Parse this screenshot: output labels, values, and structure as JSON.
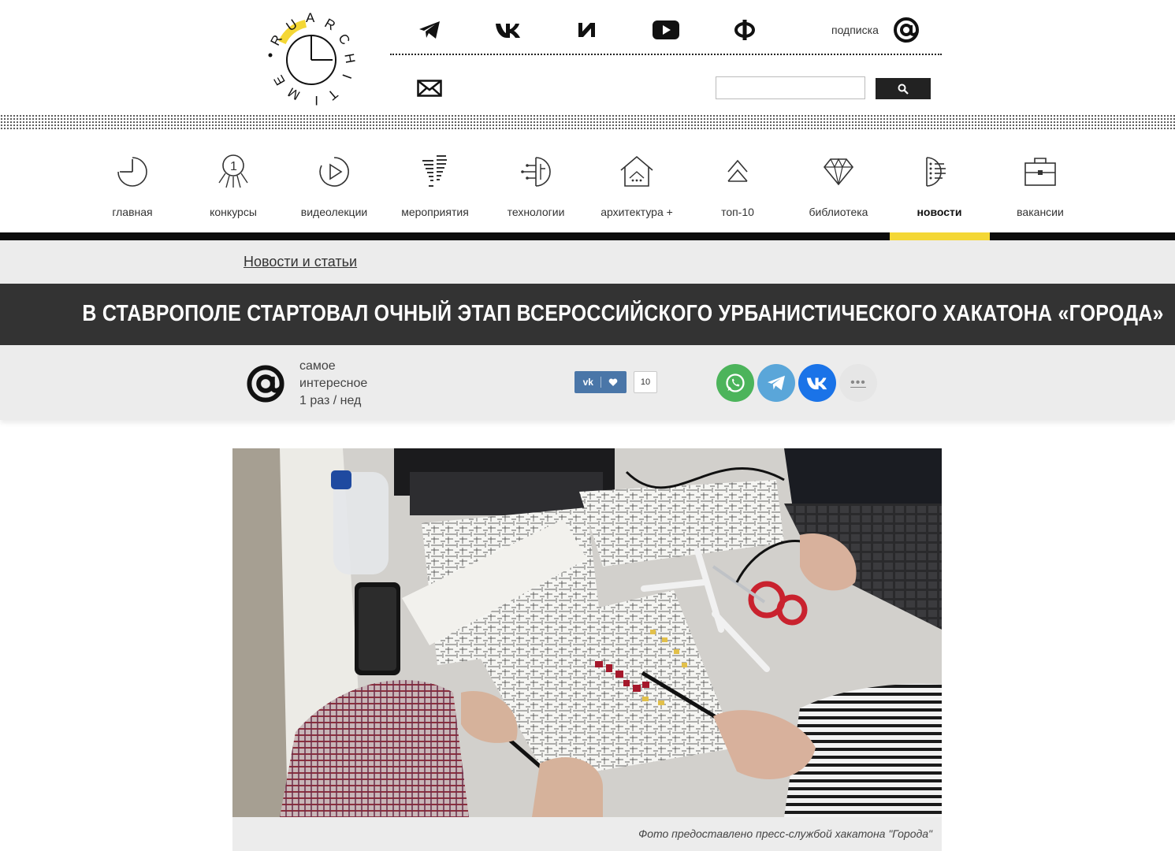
{
  "header": {
    "subscribe_label": "подписка",
    "search": {
      "value": "",
      "placeholder": ""
    },
    "social_icons": [
      "telegram-icon",
      "vk-icon",
      "i-icon",
      "youtube-icon",
      "f-icon"
    ],
    "logo_letters": [
      "R",
      "U",
      "A",
      "R",
      "C",
      "H",
      "I",
      "T",
      "I",
      "M",
      "E"
    ]
  },
  "nav": {
    "items": [
      {
        "label": "главная",
        "icon": "clock-icon"
      },
      {
        "label": "конкурсы",
        "icon": "medal-icon"
      },
      {
        "label": "видеолекции",
        "icon": "play-icon"
      },
      {
        "label": "мероприятия",
        "icon": "footprints-icon"
      },
      {
        "label": "технологии",
        "icon": "circuit-icon"
      },
      {
        "label": "архитектура +",
        "icon": "house-icon"
      },
      {
        "label": "топ-10",
        "icon": "arrows-up-icon"
      },
      {
        "label": "библиотека",
        "icon": "diamond-icon"
      },
      {
        "label": "новости",
        "icon": "list-icon"
      },
      {
        "label": "вакансии",
        "icon": "briefcase-icon"
      }
    ],
    "active_index": 8,
    "accent_color": "#f4d735"
  },
  "breadcrumb": "Новости и статьи",
  "article": {
    "title": "В СТАВРОПОЛЕ СТАРТОВАЛ ОЧНЫЙ ЭТАП ВСЕРОССИЙСКОГО УРБАНИСТИЧЕСКОГО ХАКАТОНА «ГОРОДА»",
    "photo_caption": "Фото предоставлено пресс-службой хакатона \"Города\""
  },
  "digest": {
    "line1": "самое",
    "line2": "интересное",
    "line3": "1 раз / нед"
  },
  "vk_like": {
    "vk_text": "vk",
    "count": "10",
    "color": "#4a76a8"
  },
  "share": {
    "whatsapp_color": "#4cb45b",
    "telegram_color": "#5aa6d9",
    "vk_color": "#1a73e8",
    "more_label": "•••"
  }
}
